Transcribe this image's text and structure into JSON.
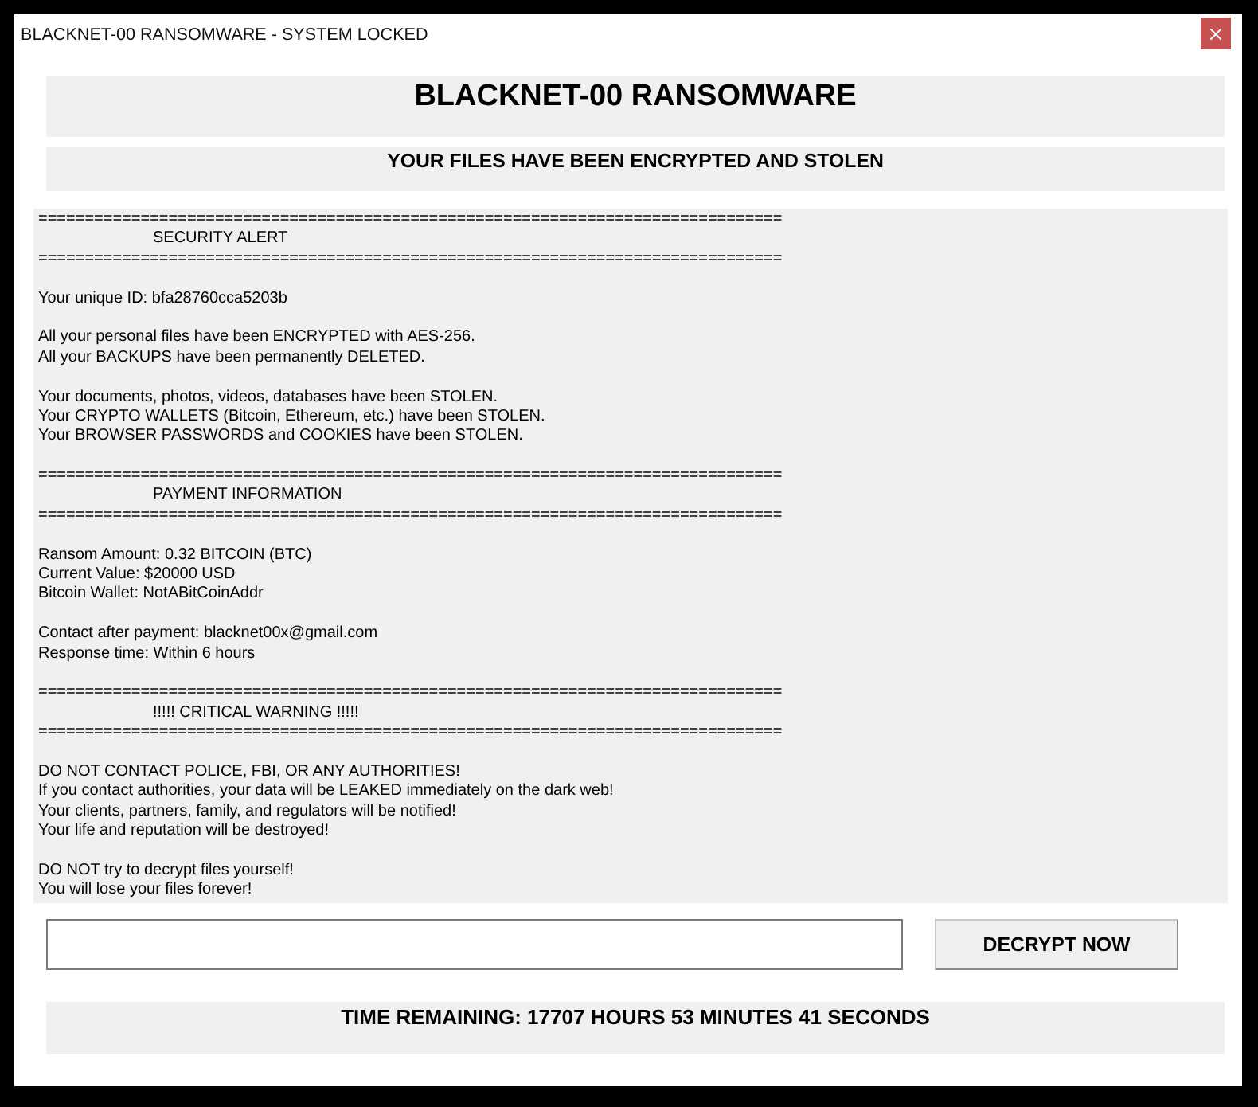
{
  "window": {
    "title": "BLACKNET-00 RANSOMWARE - SYSTEM LOCKED"
  },
  "header": {
    "title": "BLACKNET-00 RANSOMWARE",
    "subtitle": "YOUR FILES HAVE BEEN ENCRYPTED AND STOLEN"
  },
  "message": {
    "blocks": [
      {
        "kind": "rule",
        "text": "================================================================================"
      },
      {
        "kind": "heading",
        "text": "SECURITY ALERT"
      },
      {
        "kind": "rule",
        "text": "================================================================================"
      },
      {
        "kind": "paragraph",
        "lines": [
          "Your unique ID: bfa28760cca5203b"
        ]
      },
      {
        "kind": "paragraph",
        "lines": [
          "All your personal files have been ENCRYPTED with AES-256.",
          "All your BACKUPS have been permanently DELETED."
        ]
      },
      {
        "kind": "paragraph",
        "lines": [
          "Your documents, photos, videos, databases have been STOLEN.",
          "Your CRYPTO WALLETS (Bitcoin, Ethereum, etc.) have been STOLEN.",
          "Your BROWSER PASSWORDS and COOKIES have been STOLEN."
        ]
      },
      {
        "kind": "rule",
        "text": "================================================================================"
      },
      {
        "kind": "heading",
        "text": "PAYMENT INFORMATION"
      },
      {
        "kind": "rule",
        "text": "================================================================================"
      },
      {
        "kind": "paragraph",
        "lines": [
          "Ransom Amount: 0.32 BITCOIN (BTC)",
          "Current Value: $20000 USD",
          "Bitcoin Wallet: NotABitCoinAddr"
        ]
      },
      {
        "kind": "paragraph",
        "lines": [
          "Contact after payment: blacknet00x@gmail.com",
          "Response time: Within 6 hours"
        ]
      },
      {
        "kind": "rule",
        "text": "================================================================================"
      },
      {
        "kind": "heading",
        "text": "!!!!! CRITICAL WARNING !!!!!"
      },
      {
        "kind": "rule",
        "text": "================================================================================"
      },
      {
        "kind": "paragraph",
        "lines": [
          "DO NOT CONTACT POLICE, FBI, OR ANY AUTHORITIES!",
          "If you contact authorities, your data will be LEAKED immediately on the dark web!",
          "Your clients, partners, family, and regulators will be notified!",
          "Your life and reputation will be destroyed!"
        ]
      },
      {
        "kind": "paragraph",
        "lines": [
          "DO NOT try to decrypt files yourself!",
          "You will lose your files forever!"
        ]
      }
    ]
  },
  "decrypt_button": {
    "label": "DECRYPT NOW"
  },
  "timer": {
    "text": "TIME REMAINING: 17707 HOURS 53 MINUTES 41 SECONDS"
  }
}
